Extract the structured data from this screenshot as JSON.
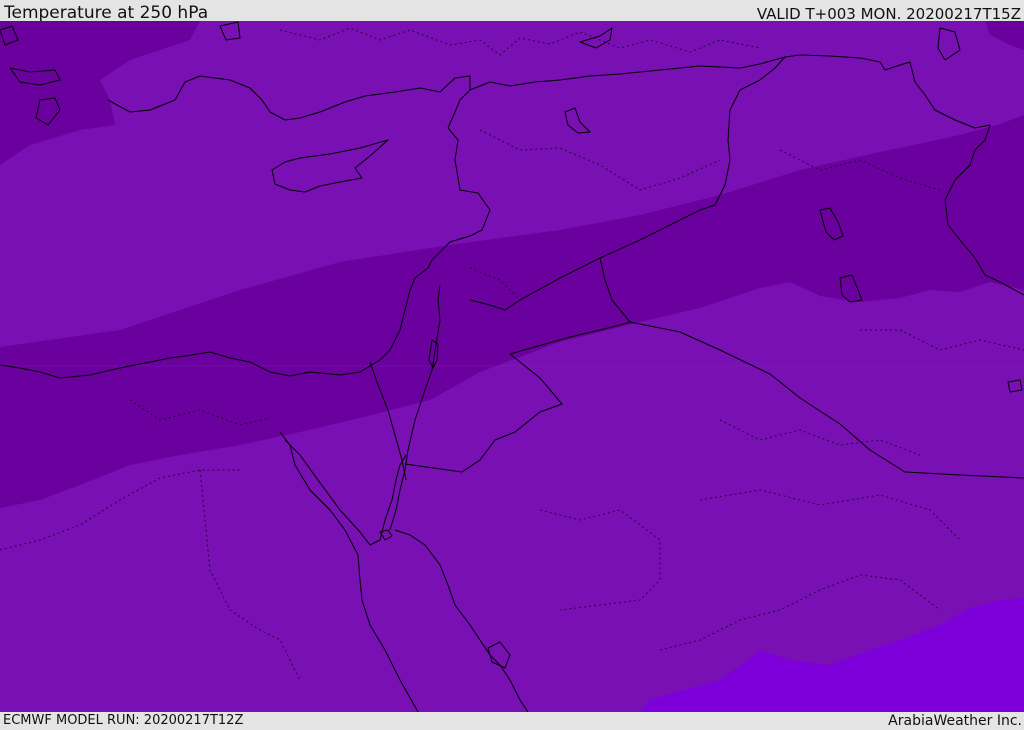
{
  "header": {
    "title": "Temperature at 250 hPa",
    "valid_time": "VALID T+003 MON. 20200217T15Z"
  },
  "footer": {
    "model_run": "ECMWF MODEL RUN: 20200217T12Z",
    "credit": "ArabiaWeather Inc."
  },
  "map": {
    "field": "temperature",
    "level": "250 hPa",
    "region": "Eastern Mediterranean / Middle East",
    "colors": {
      "band_light": "#7810b3",
      "band_dark": "#6a019e",
      "band_lightest": "#7d00da",
      "coastline": "#000000",
      "border": "#000000"
    }
  }
}
